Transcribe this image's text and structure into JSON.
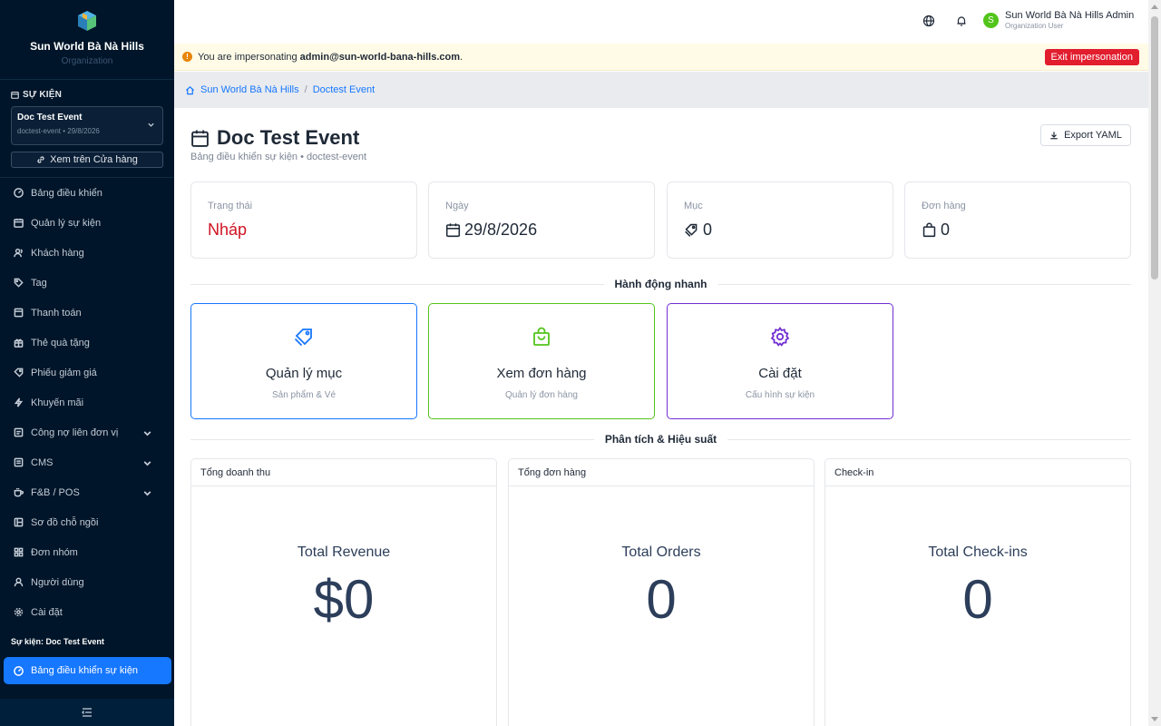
{
  "sidebar": {
    "org_name": "Sun World Bà Nà Hills",
    "org_sub": "Organization",
    "section_label": "SỰ KIỆN",
    "event_select": {
      "name": "Doc Test Event",
      "meta": "doctest-event • 29/8/2026"
    },
    "view_store_label": "Xem trên Cửa hàng",
    "items": [
      {
        "label": "Bảng điều khiển",
        "icon": "dashboard-icon"
      },
      {
        "label": "Quản lý sự kiện",
        "icon": "calendar-icon"
      },
      {
        "label": "Khách hàng",
        "icon": "users-icon"
      },
      {
        "label": "Tag",
        "icon": "tag-icon"
      },
      {
        "label": "Thanh toán",
        "icon": "payment-icon"
      },
      {
        "label": "Thẻ quà tặng",
        "icon": "gift-icon"
      },
      {
        "label": "Phiếu giảm giá",
        "icon": "coupon-icon"
      },
      {
        "label": "Khuyến mãi",
        "icon": "lightning-icon"
      },
      {
        "label": "Công nợ liên đơn vị",
        "icon": "debt-icon",
        "expandable": true
      },
      {
        "label": "CMS",
        "icon": "cms-icon",
        "expandable": true
      },
      {
        "label": "F&B / POS",
        "icon": "coffee-icon",
        "expandable": true
      },
      {
        "label": "Sơ đồ chỗ ngồi",
        "icon": "seat-map-icon"
      },
      {
        "label": "Đơn nhóm",
        "icon": "group-icon"
      },
      {
        "label": "Người dùng",
        "icon": "user-icon"
      },
      {
        "label": "Cài đặt",
        "icon": "settings-icon"
      }
    ],
    "event_section_label": "Sự kiện: Doc Test Event",
    "active_item_label": "Bảng điều khiển sự kiện"
  },
  "header": {
    "user_name": "Sun World Bà Nà Hills Admin",
    "user_role": "Organization User",
    "avatar_letter": "S"
  },
  "banner": {
    "prefix": "You are impersonating",
    "email": "admin@sun-world-bana-hills.com",
    "suffix": ".",
    "exit_label": "Exit impersonation"
  },
  "breadcrumb": {
    "home": "Sun World Bà Nà Hills",
    "separator": "/",
    "current": "Doctest Event"
  },
  "page": {
    "title": "Doc Test Event",
    "subtitle": "Bảng điều khiển sự kiện • doctest-event",
    "export_label": "Export YAML"
  },
  "stats": [
    {
      "label": "Trạng thái",
      "value": "Nháp"
    },
    {
      "label": "Ngày",
      "value": "29/8/2026"
    },
    {
      "label": "Mục",
      "value": "0"
    },
    {
      "label": "Đơn hàng",
      "value": "0"
    }
  ],
  "quick_actions": {
    "heading": "Hành động nhanh",
    "items": [
      {
        "title": "Quản lý mục",
        "desc": "Sản phẩm & Vé",
        "color": "#1677ff"
      },
      {
        "title": "Xem đơn hàng",
        "desc": "Quản lý đơn hàng",
        "color": "#52c41a"
      },
      {
        "title": "Cài đặt",
        "desc": "Cấu hình sự kiện",
        "color": "#722ed1"
      }
    ]
  },
  "analytics": {
    "heading": "Phân tích & Hiệu suất",
    "cards": [
      {
        "header": "Tổng doanh thu",
        "metric_title": "Total Revenue",
        "value": "$0"
      },
      {
        "header": "Tổng đơn hàng",
        "metric_title": "Total Orders",
        "value": "0"
      },
      {
        "header": "Check-in",
        "metric_title": "Total Check-ins",
        "value": "0"
      }
    ]
  },
  "colors": {
    "sidebar_bg": "#001529",
    "primary": "#1677ff",
    "danger": "#e11d2e",
    "draft": "#cf1322",
    "metric_text": "#2c3e5a"
  }
}
